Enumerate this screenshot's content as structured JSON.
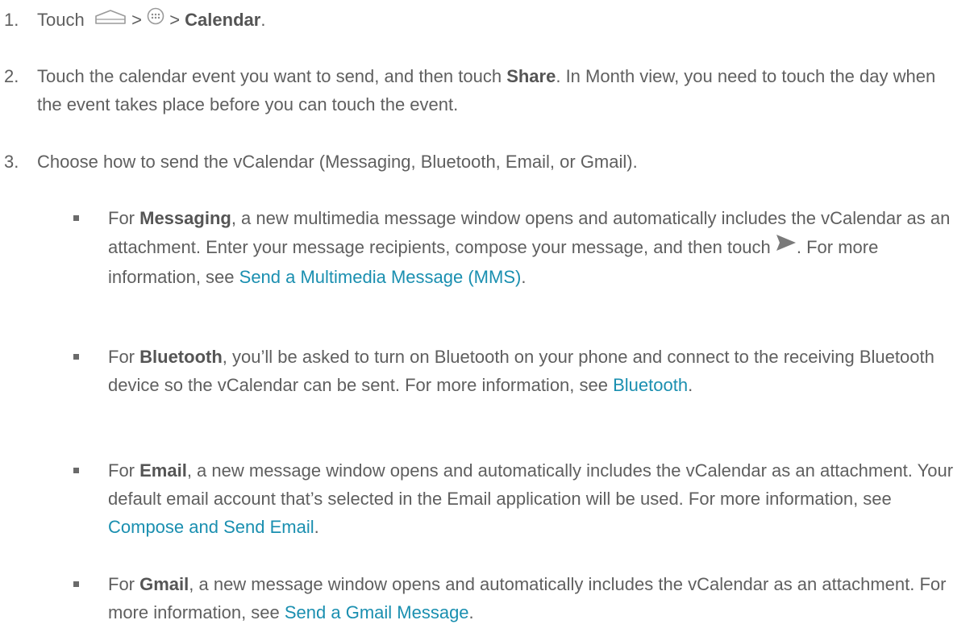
{
  "steps": [
    {
      "number": "1.",
      "pre": "Touch",
      "sep1": ">",
      "sep2": ">",
      "bold": "Calendar",
      "post": ".",
      "icons": [
        "home-icon",
        "apps-icon"
      ]
    },
    {
      "number": "2.",
      "pre": "Touch the calendar event you want to send, and then touch ",
      "bold": "Share",
      "post": ". In Month view, you need to touch the day when the event takes place before you can touch the event."
    },
    {
      "number": "3.",
      "text": "Choose how to send the vCalendar (Messaging, Bluetooth, Email, or Gmail)."
    }
  ],
  "bullets": [
    {
      "pre": "For ",
      "bold": "Messaging",
      "mid": ", a new multimedia message window opens and automatically includes the vCalendar as an attachment. Enter your message recipients, compose your message, and then touch ",
      "icon": "send-icon",
      "after": ". For more information, see ",
      "link": "Send a Multimedia Message (MMS)",
      "post": "."
    },
    {
      "pre": "For ",
      "bold": "Bluetooth",
      "mid": ", you’ll be asked to turn on Bluetooth on your phone and connect to the receiving Bluetooth device so the vCalendar can be sent. For more information, see ",
      "link": "Bluetooth",
      "post": "."
    },
    {
      "pre": "For ",
      "bold": "Email",
      "mid": ", a new message window opens and automatically includes the vCalendar as an attachment. Your default email account that’s selected in the Email application will be used. For more information, see ",
      "link": "Compose and Send Email",
      "post": "."
    },
    {
      "pre": "For ",
      "bold": "Gmail",
      "mid": ", a new message window opens and automatically includes the vCalendar as an attachment. For more information, see ",
      "link": "Send a Gmail Message",
      "post": "."
    }
  ],
  "colors": {
    "text": "#5f5f5f",
    "link": "#1a8fb0",
    "bullet": "#6a6a6a"
  }
}
